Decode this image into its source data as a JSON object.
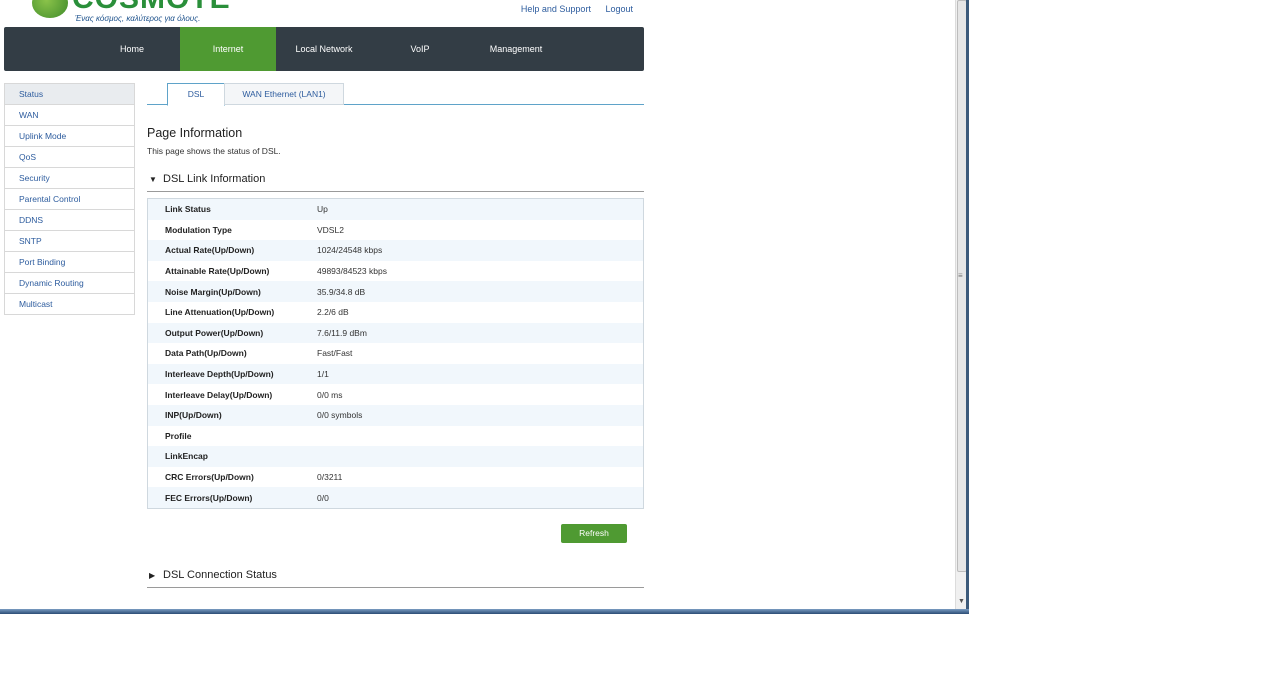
{
  "header": {
    "brand": "COSMOTE",
    "tagline": "Ένας κόσμος, καλύτερος για όλους.",
    "links": [
      "Help and Support",
      "Logout"
    ]
  },
  "mainnav": {
    "items": [
      "Home",
      "Internet",
      "Local Network",
      "VoIP",
      "Management"
    ],
    "active": "Internet"
  },
  "sidebar": {
    "items": [
      "Status",
      "WAN",
      "Uplink Mode",
      "QoS",
      "Security",
      "Parental Control",
      "DDNS",
      "SNTP",
      "Port Binding",
      "Dynamic Routing",
      "Multicast"
    ],
    "active": "Status"
  },
  "tabs": [
    "DSL",
    "WAN Ethernet (LAN1)"
  ],
  "page": {
    "title": "Page Information",
    "description": "This page shows the status of DSL."
  },
  "dsl_link": {
    "heading": "DSL Link Information",
    "rows": [
      {
        "label": "Link Status",
        "value": "Up"
      },
      {
        "label": "Modulation Type",
        "value": "VDSL2"
      },
      {
        "label": "Actual Rate(Up/Down)",
        "value": "1024/24548 kbps"
      },
      {
        "label": "Attainable Rate(Up/Down)",
        "value": "49893/84523 kbps"
      },
      {
        "label": "Noise Margin(Up/Down)",
        "value": "35.9/34.8 dB"
      },
      {
        "label": "Line Attenuation(Up/Down)",
        "value": "2.2/6 dB"
      },
      {
        "label": "Output Power(Up/Down)",
        "value": "7.6/11.9 dBm"
      },
      {
        "label": "Data Path(Up/Down)",
        "value": "Fast/Fast"
      },
      {
        "label": "Interleave Depth(Up/Down)",
        "value": "1/1"
      },
      {
        "label": "Interleave Delay(Up/Down)",
        "value": "0/0 ms"
      },
      {
        "label": "INP(Up/Down)",
        "value": "0/0 symbols"
      },
      {
        "label": "Profile",
        "value": ""
      },
      {
        "label": "LinkEncap",
        "value": ""
      },
      {
        "label": "CRC Errors(Up/Down)",
        "value": "0/3211"
      },
      {
        "label": "FEC Errors(Up/Down)",
        "value": "0/0"
      }
    ]
  },
  "refresh_label": "Refresh",
  "dsl_conn": {
    "heading": "DSL Connection Status"
  }
}
